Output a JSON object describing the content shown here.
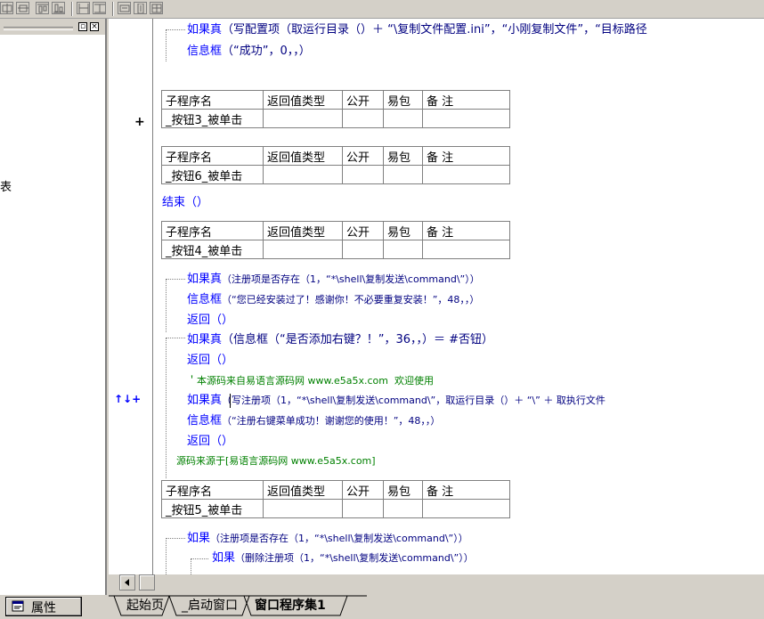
{
  "toolbar": {
    "icons": [
      "align-left-icon",
      "align-center-icon",
      "align-top-icon",
      "align-bottom-icon",
      "same-width-icon",
      "same-height-icon",
      "hspace-icon",
      "vspace-icon",
      "center-icon"
    ]
  },
  "left_panel": {
    "truncated_text": "表",
    "properties_button": "属性"
  },
  "tabs": [
    "起始页",
    "_启动窗口",
    "窗口程序集1"
  ],
  "sub_table_headers": [
    "子程序名",
    "返回值类型",
    "公开",
    "易包",
    "备 注"
  ],
  "code": {
    "l1_kw": "如果真",
    "l1_rest": "（写配置项（取运行目录（）＋ “\\复制文件配置.ini”，“小刚复制文件”，“目标路径",
    "l2_kw": "信息框",
    "l2_rest": "（“成功”，0，，）",
    "sub1": "_按钮3_被单击",
    "sub2": "_按钮6_被单击",
    "end_line": "结束（）",
    "sub3": "_按钮4_被单击",
    "c1_kw": "如果真",
    "c1_rest": "（注册项是否存在（1，“*\\shell\\复制发送\\command\\”））",
    "c2_kw": "信息框",
    "c2_rest": "（“您已经安装过了！感谢你！不必要重复安装！”，48，，）",
    "c3": "返回（）",
    "c4_kw": "如果真",
    "c4_rest": "（信息框（“是否添加右键？！”，36，，）＝ #否钮）",
    "c5": "返回（）",
    "c6": "＇本源码来自易语言源码网 www.e5a5x.com  欢迎使用",
    "c7_kw": "如果真",
    "c7_rest": "（写注册项（1，“*\\shell\\复制发送\\command\\”，取运行目录（）＋ “\\” ＋ 取执行文件",
    "c8_kw": "信息框",
    "c8_rest": "（“注册右键菜单成功！谢谢您的使用！”，48，，）",
    "c9": "返回（）",
    "c10": "源码来源于[易语言源码网 www.e5a5x.com]",
    "sub4": "_按钮5_被单击",
    "d1_kw": "如果",
    "d1_rest": "（注册项是否存在（1，“*\\shell\\复制发送\\command\\”））",
    "d2_kw": "如果",
    "d2_rest": "（删除注册项（1，“*\\shell\\复制发送\\command\\”））"
  },
  "gutter": {
    "plus": "+",
    "arrows_plus": "↑↓+"
  }
}
